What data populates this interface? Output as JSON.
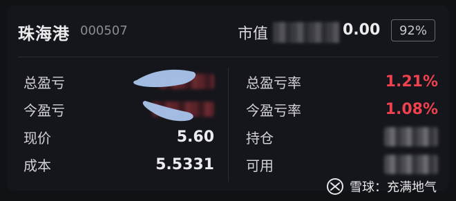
{
  "stock": {
    "name": "珠海港",
    "code": "000507"
  },
  "market_value": {
    "label": "市值",
    "value_visible": "0.00",
    "position_pct": "92%"
  },
  "left_rows": [
    {
      "label": "总盈亏",
      "value": ""
    },
    {
      "label": "今盈亏",
      "value": ""
    },
    {
      "label": "现价",
      "value": "5.60"
    },
    {
      "label": "成本",
      "value": "5.5331"
    }
  ],
  "right_rows": [
    {
      "label": "总盈亏率",
      "value": "1.21%"
    },
    {
      "label": "今盈亏率",
      "value": "1.08%"
    },
    {
      "label": "持仓",
      "value": ""
    },
    {
      "label": "可用",
      "value": ""
    }
  ],
  "watermark": {
    "text": "雪球：充满地气",
    "logo": "xueqiu-logo-icon"
  },
  "colors": {
    "background": "#111216",
    "card": "#15161b",
    "profit_red": "#f0414e",
    "text": "#ececef"
  }
}
